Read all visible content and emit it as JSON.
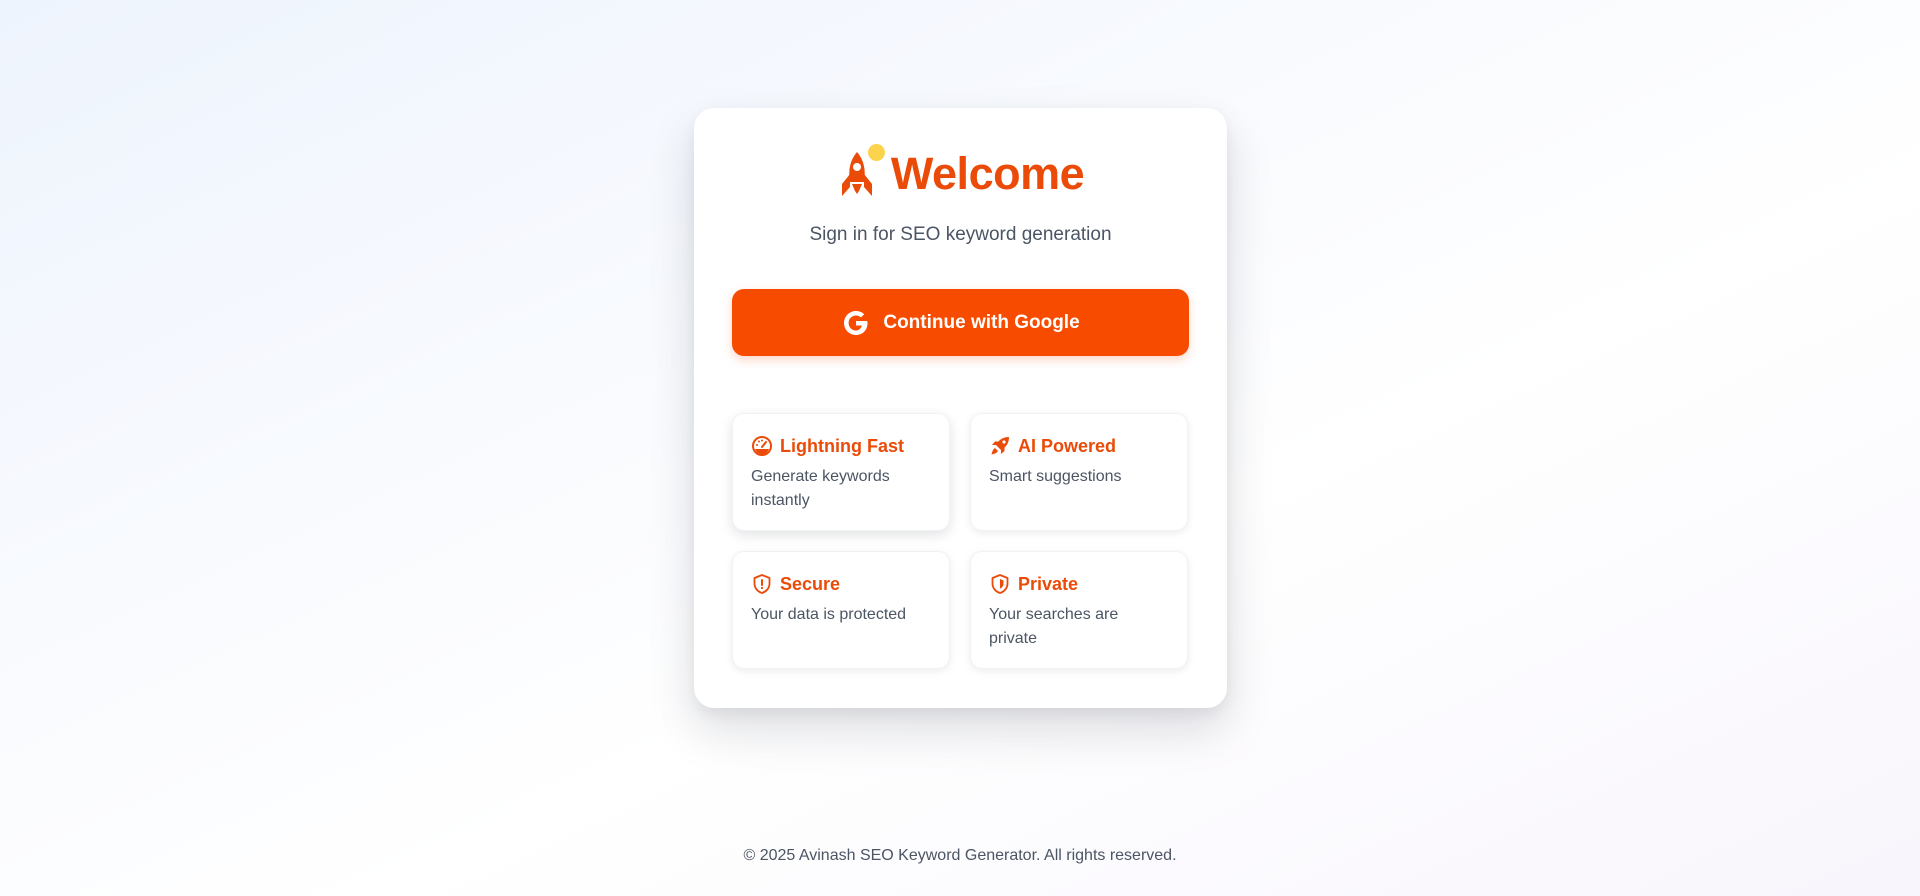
{
  "header": {
    "title": "Welcome",
    "subtitle": "Sign in for SEO keyword generation",
    "logo_icon": "rocket-icon"
  },
  "login": {
    "google_label": "Continue with Google",
    "google_icon": "google-icon"
  },
  "features": [
    {
      "icon": "speedometer-icon",
      "title": "Lightning Fast",
      "description": "Generate keywords instantly"
    },
    {
      "icon": "rocket-icon",
      "title": "AI Powered",
      "description": "Smart suggestions"
    },
    {
      "icon": "shield-icon",
      "title": "Secure",
      "description": "Your data is protected"
    },
    {
      "icon": "shield-icon",
      "title": "Private",
      "description": "Your searches are private"
    }
  ],
  "footer": {
    "text": "© 2025 Avinash SEO Keyword Generator. All rights reserved."
  },
  "colors": {
    "accent": "#f74b00",
    "heading": "#ea4b08",
    "dot": "#fcd34d",
    "text": "#4b5563"
  }
}
